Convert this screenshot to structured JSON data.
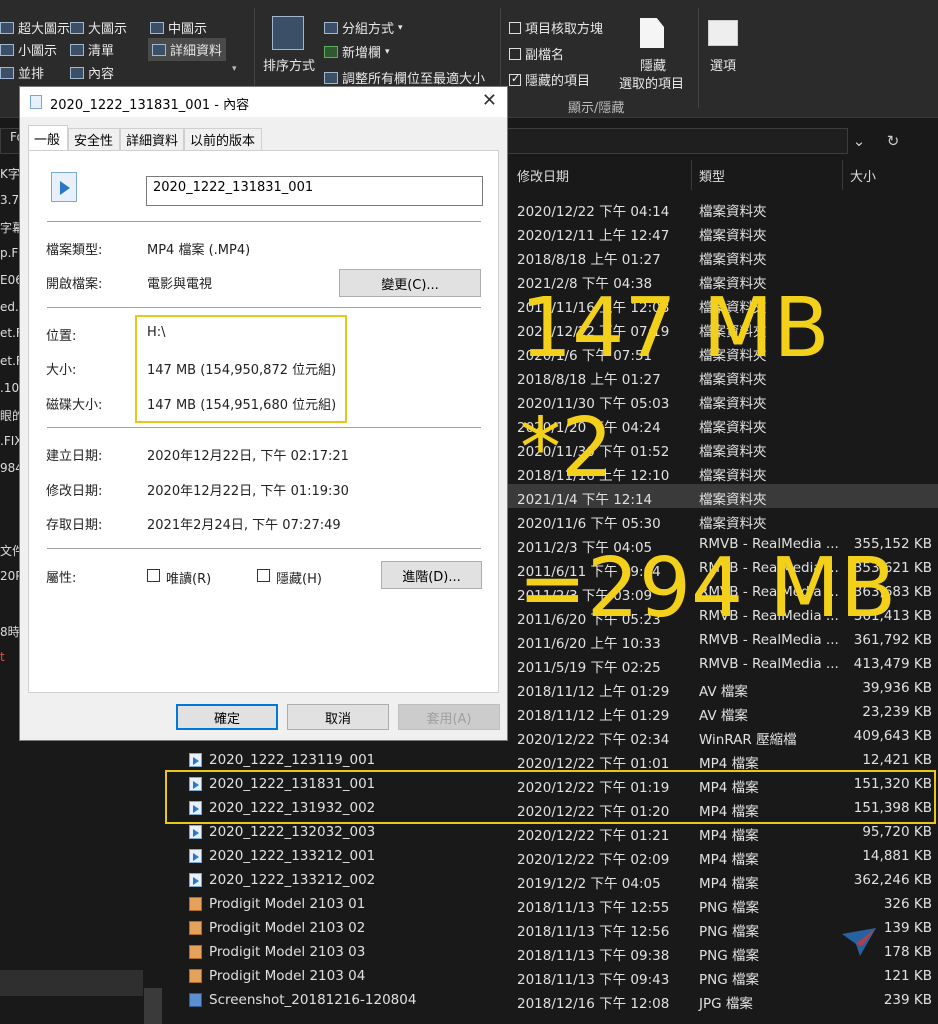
{
  "ribbon": {
    "layout_items": [
      "超大圖示",
      "大圖示",
      "中圖示",
      "小圖示",
      "清單",
      "詳細資料",
      "並排",
      "內容"
    ],
    "sort_label": "排序方式",
    "group_by": "分組方式",
    "add_column": "新增欄",
    "fit_columns": "調整所有欄位至最適大小",
    "checkboxes": [
      {
        "label": "項目核取方塊",
        "checked": false
      },
      {
        "label": "副檔名",
        "checked": false
      },
      {
        "label": "隱藏的項目",
        "checked": true
      }
    ],
    "hide_selected": "隱藏\n選取的項目",
    "hide_line1": "隱藏",
    "hide_line2": "選取的項目",
    "options": "選項",
    "group_caption": "顯示/隱藏"
  },
  "columns": {
    "date": "修改日期",
    "type": "類型",
    "size": "大小"
  },
  "left_fragments": [
    "Fo",
    "K字",
    "3.7",
    "字幕",
    "p.F",
    "E06",
    "ed.D",
    "et.F",
    "et.F",
    ".10",
    "眼的",
    ".FIX",
    "984",
    "文件",
    "20P",
    "8時",
    "t"
  ],
  "files": [
    {
      "name": "",
      "date": "2020/12/22 下午 04:14",
      "type": "檔案資料夾",
      "size": "",
      "icon": "folder"
    },
    {
      "name": "",
      "date": "2020/12/11 上午 12:47",
      "type": "檔案資料夾",
      "size": "",
      "icon": "folder"
    },
    {
      "name": "",
      "date": "2018/8/18 上午 01:27",
      "type": "檔案資料夾",
      "size": "",
      "icon": "folder"
    },
    {
      "name": "",
      "date": "2021/2/8 下午 04:38",
      "type": "檔案資料夾",
      "size": "",
      "icon": "folder"
    },
    {
      "name": "",
      "date": "2018/11/16 上午 12:08",
      "type": "檔案資料夾",
      "size": "",
      "icon": "folder"
    },
    {
      "name": "",
      "date": "2020/12/22 下午 07:19",
      "type": "檔案資料夾",
      "size": "",
      "icon": "folder"
    },
    {
      "name": "",
      "date": "2020/1/6 下午 07:51",
      "type": "檔案資料夾",
      "size": "",
      "icon": "folder"
    },
    {
      "name": "",
      "date": "2018/8/18 上午 01:27",
      "type": "檔案資料夾",
      "size": "",
      "icon": "folder"
    },
    {
      "name": "",
      "date": "2020/11/30 下午 05:03",
      "type": "檔案資料夾",
      "size": "",
      "icon": "folder"
    },
    {
      "name": "",
      "date": "2020/1/20 下午 04:24",
      "type": "檔案資料夾",
      "size": "",
      "icon": "folder"
    },
    {
      "name": "",
      "date": "2020/11/30 下午 01:52",
      "type": "檔案資料夾",
      "size": "",
      "icon": "folder"
    },
    {
      "name": "",
      "date": "2018/11/16 上午 12:10",
      "type": "檔案資料夾",
      "size": "",
      "icon": "folder"
    },
    {
      "name": "",
      "date": "2021/1/4 下午 12:14",
      "type": "檔案資料夾",
      "size": "",
      "icon": "folder",
      "highlight": true
    },
    {
      "name": "",
      "date": "2020/11/6 下午 05:30",
      "type": "檔案資料夾",
      "size": "",
      "icon": "folder"
    },
    {
      "name": "",
      "date": "2011/2/3 下午 04:05",
      "type": "RMVB - RealMedia ...",
      "size": "355,152 KB",
      "icon": "rmvb"
    },
    {
      "name": "",
      "date": "2011/6/11 下午 09:04",
      "type": "RMVB - RealMedia ...",
      "size": "353,621 KB",
      "icon": "rmvb"
    },
    {
      "name": "",
      "date": "2011/2/3 下午 03:09",
      "type": "RMVB - RealMedia ...",
      "size": "363,683 KB",
      "icon": "rmvb"
    },
    {
      "name": "",
      "date": "2011/6/20 下午 05:23",
      "type": "RMVB - RealMedia ...",
      "size": "361,413 KB",
      "icon": "rmvb"
    },
    {
      "name": "",
      "date": "2011/6/20 上午 10:33",
      "type": "RMVB - RealMedia ...",
      "size": "361,792 KB",
      "icon": "rmvb"
    },
    {
      "name": "",
      "date": "2011/5/19 下午 02:25",
      "type": "RMVB - RealMedia ...",
      "size": "413,479 KB",
      "icon": "rmvb"
    },
    {
      "name": "",
      "date": "2018/11/12 上午 01:29",
      "type": "AV 檔案",
      "size": "39,936 KB",
      "icon": "av"
    },
    {
      "name": "",
      "date": "2018/11/12 上午 01:29",
      "type": "AV 檔案",
      "size": "23,239 KB",
      "icon": "av"
    },
    {
      "name": "",
      "date": "2020/12/22 下午 02:34",
      "type": "WinRAR 壓縮檔",
      "size": "409,643 KB",
      "icon": "rar"
    },
    {
      "name": "2020_1222_123119_001",
      "date": "2020/12/22 下午 01:01",
      "type": "MP4 檔案",
      "size": "12,421 KB",
      "icon": "mp4"
    },
    {
      "name": "2020_1222_131831_001",
      "date": "2020/12/22 下午 01:19",
      "type": "MP4 檔案",
      "size": "151,320 KB",
      "icon": "mp4"
    },
    {
      "name": "2020_1222_131932_002",
      "date": "2020/12/22 下午 01:20",
      "type": "MP4 檔案",
      "size": "151,398 KB",
      "icon": "mp4"
    },
    {
      "name": "2020_1222_132032_003",
      "date": "2020/12/22 下午 01:21",
      "type": "MP4 檔案",
      "size": "95,720 KB",
      "icon": "mp4"
    },
    {
      "name": "2020_1222_133212_001",
      "date": "2020/12/22 下午 02:09",
      "type": "MP4 檔案",
      "size": "14,881 KB",
      "icon": "mp4"
    },
    {
      "name": "2020_1222_133212_002",
      "date": "2019/12/2 下午 04:05",
      "type": "MP4 檔案",
      "size": "362,246 KB",
      "icon": "mp4"
    },
    {
      "name": "Prodigit Model 2103 01",
      "date": "2018/11/13 下午 12:55",
      "type": "PNG 檔案",
      "size": "326 KB",
      "icon": "png"
    },
    {
      "name": "Prodigit Model 2103 02",
      "date": "2018/11/13 下午 12:56",
      "type": "PNG 檔案",
      "size": "139 KB",
      "icon": "png"
    },
    {
      "name": "Prodigit Model 2103 03",
      "date": "2018/11/13 下午 09:38",
      "type": "PNG 檔案",
      "size": "178 KB",
      "icon": "png"
    },
    {
      "name": "Prodigit Model 2103 04",
      "date": "2018/11/13 下午 09:43",
      "type": "PNG 檔案",
      "size": "121 KB",
      "icon": "png"
    },
    {
      "name": "Screenshot_20181216-120804",
      "date": "2018/12/16 下午 12:08",
      "type": "JPG 檔案",
      "size": "239 KB",
      "icon": "jpg"
    }
  ],
  "dialog": {
    "title": "2020_1222_131831_001 - 內容",
    "tabs": [
      "一般",
      "安全性",
      "詳細資料",
      "以前的版本"
    ],
    "file_name": "2020_1222_131831_001",
    "file_type_label": "檔案類型:",
    "file_type": "MP4 檔案 (.MP4)",
    "opens_with_label": "開啟檔案:",
    "opens_with": "電影與電視",
    "change_button": "變更(C)...",
    "location_label": "位置:",
    "location": "H:\\",
    "size_label": "大小:",
    "size": "147 MB (154,950,872 位元組)",
    "disk_size_label": "磁碟大小:",
    "disk_size": "147 MB (154,951,680 位元組)",
    "created_label": "建立日期:",
    "created": "2020年12月22日, 下午 02:17:21",
    "modified_label": "修改日期:",
    "modified": "2020年12月22日, 下午 01:19:30",
    "accessed_label": "存取日期:",
    "accessed": "2021年2月24日, 下午 07:27:49",
    "attributes_label": "屬性:",
    "readonly": "唯讀(R)",
    "hidden": "隱藏(H)",
    "advanced_button": "進階(D)...",
    "ok_button": "確定",
    "cancel_button": "取消",
    "apply_button": "套用(A)"
  },
  "annotation": {
    "line1": "147 MB",
    "line2": "*2",
    "line3": "=294 MB",
    "color": "#f3d11a"
  }
}
